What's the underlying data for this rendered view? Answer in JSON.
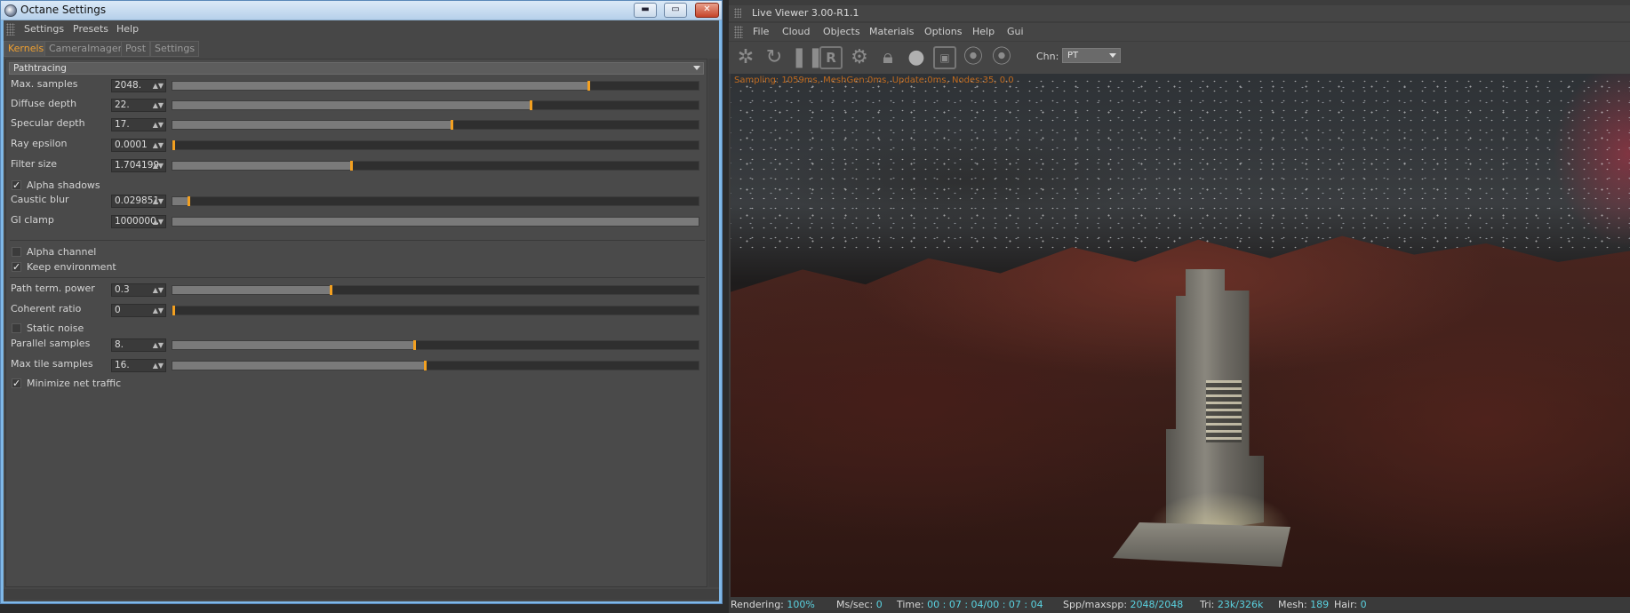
{
  "settings_window": {
    "title": "Octane Settings",
    "controls": {
      "minimize": "▬",
      "maximize": "▭",
      "close": "✕"
    },
    "menu": [
      "Settings",
      "Presets",
      "Help"
    ],
    "tabs": [
      "Kernels",
      "CameraImager",
      "Post",
      "Settings"
    ],
    "active_tab": "Kernels",
    "kernel_type": "Pathtracing",
    "params": [
      {
        "label": "Max. samples",
        "value": "2048.",
        "level": 0.79
      },
      {
        "label": "Diffuse depth",
        "value": "22.",
        "level": 0.68
      },
      {
        "label": "Specular depth",
        "value": "17.",
        "level": 0.53
      },
      {
        "label": "Ray epsilon",
        "value": "0.0001",
        "level": 0.0
      },
      {
        "label": "Filter size",
        "value": "1.704199",
        "level": 0.34
      }
    ],
    "check_alpha_shadows": {
      "label": "Alpha shadows",
      "checked": true
    },
    "params2": [
      {
        "label": "Caustic blur",
        "value": "0.029851",
        "level": 0.03
      },
      {
        "label": "GI clamp",
        "value": "1000000.",
        "level": 1.0
      }
    ],
    "check_alpha_channel": {
      "label": "Alpha channel",
      "checked": false
    },
    "check_keep_env": {
      "label": "Keep environment",
      "checked": true
    },
    "params3": [
      {
        "label": "Path term. power",
        "value": "0.3",
        "level": 0.3
      },
      {
        "label": "Coherent ratio",
        "value": "0",
        "level": 0.0
      }
    ],
    "check_static_noise": {
      "label": "Static noise",
      "checked": false
    },
    "params4": [
      {
        "label": "Parallel samples",
        "value": "8.",
        "level": 0.46
      },
      {
        "label": "Max tile samples",
        "value": "16.",
        "level": 0.48
      }
    ],
    "check_min_net": {
      "label": "Minimize net traffic",
      "checked": true
    }
  },
  "viewer": {
    "title": "Live Viewer 3.00-R1.1",
    "menu": [
      "File",
      "Cloud",
      "Objects",
      "Materials",
      "Options",
      "Help",
      "Gui"
    ],
    "toolbar_icons": [
      "aperture-icon",
      "refresh-icon",
      "pause-icon",
      "region-render-icon",
      "gear-icon",
      "lock-icon",
      "material-ball-icon",
      "clay-mode-icon",
      "focus-pick-icon",
      "material-pick-icon"
    ],
    "region_letter": "R",
    "channel_label": "Chn:",
    "channel_value": "PT",
    "render_stats": "Sampling: 1059ms, MeshGen:0ms, Update:0ms, Nodes:35, 0.0",
    "status": {
      "rendering_label": "Rendering:",
      "rendering_value": "100%",
      "mssec_label": "Ms/sec:",
      "mssec_value": "0",
      "time_label": "Time:",
      "time_value": "00 : 07 : 04/00 : 07 : 04",
      "spp_label": "Spp/maxspp:",
      "spp_value": "2048/2048",
      "tri_label": "Tri:",
      "tri_value": "23k/326k",
      "mesh_label": "Mesh:",
      "mesh_value": "189",
      "hair_label": "Hair:",
      "hair_value": "0"
    }
  },
  "colors": {
    "accent_orange": "#f3a020",
    "status_cyan": "#5ad2e0",
    "render_text": "#c06a1e"
  }
}
